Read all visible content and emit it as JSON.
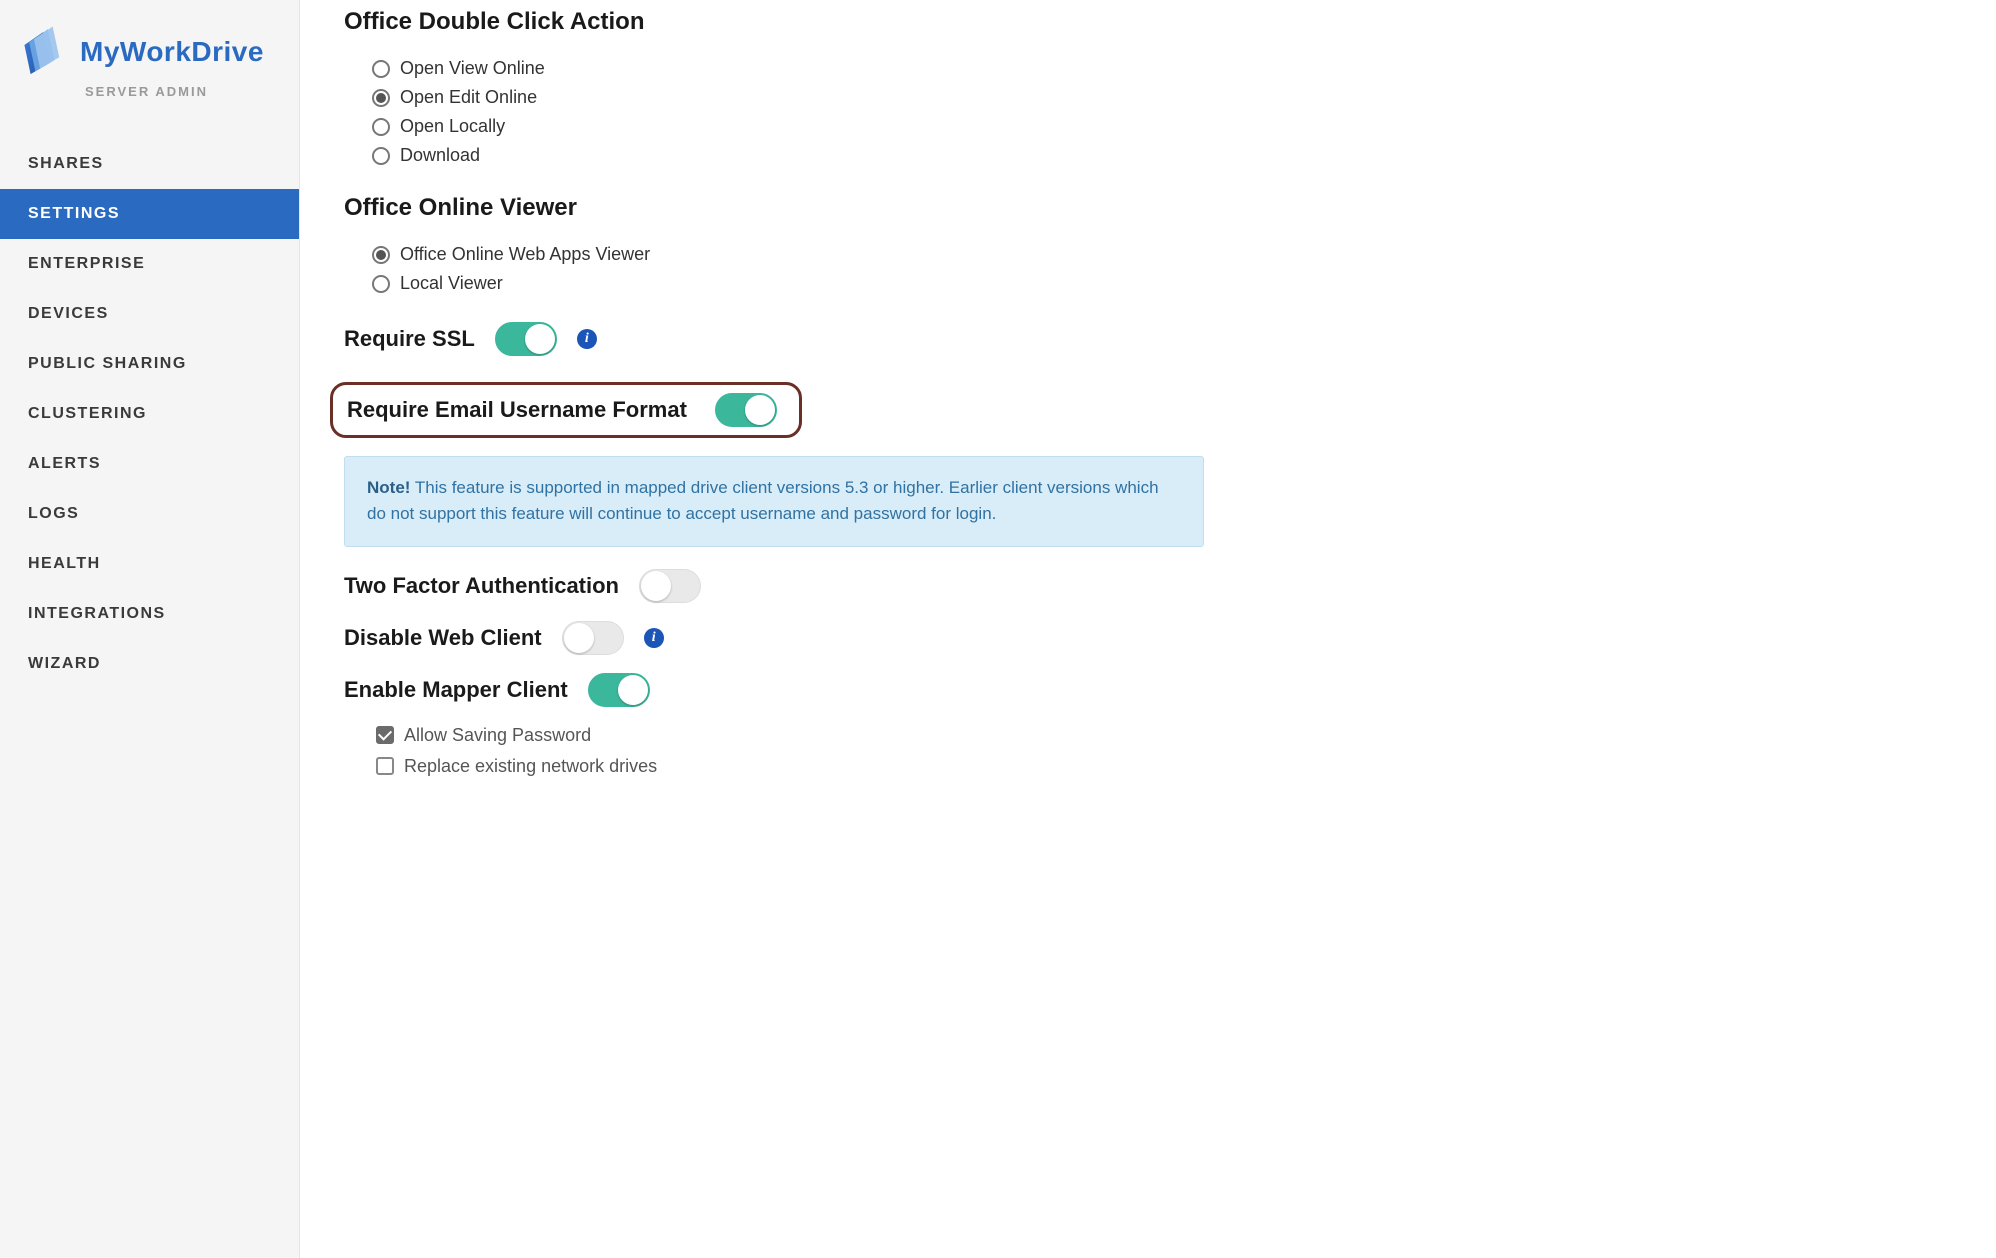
{
  "brand": {
    "name": "MyWorkDrive",
    "subtitle": "SERVER ADMIN"
  },
  "sidebar": {
    "items": [
      {
        "label": "SHARES",
        "active": false
      },
      {
        "label": "SETTINGS",
        "active": true
      },
      {
        "label": "ENTERPRISE",
        "active": false
      },
      {
        "label": "DEVICES",
        "active": false
      },
      {
        "label": "PUBLIC SHARING",
        "active": false
      },
      {
        "label": "CLUSTERING",
        "active": false
      },
      {
        "label": "ALERTS",
        "active": false
      },
      {
        "label": "LOGS",
        "active": false
      },
      {
        "label": "HEALTH",
        "active": false
      },
      {
        "label": "INTEGRATIONS",
        "active": false
      },
      {
        "label": "WIZARD",
        "active": false
      }
    ]
  },
  "sections": {
    "doubleClick": {
      "title": "Office Double Click Action",
      "options": [
        {
          "label": "Open View Online",
          "checked": false
        },
        {
          "label": "Open Edit Online",
          "checked": true
        },
        {
          "label": "Open Locally",
          "checked": false
        },
        {
          "label": "Download",
          "checked": false
        }
      ]
    },
    "onlineViewer": {
      "title": "Office Online Viewer",
      "options": [
        {
          "label": "Office Online Web Apps Viewer",
          "checked": true
        },
        {
          "label": "Local Viewer",
          "checked": false
        }
      ]
    },
    "requireSsl": {
      "label": "Require SSL",
      "on": true
    },
    "requireEmail": {
      "label": "Require Email Username Format",
      "on": true
    },
    "note": {
      "prefix": "Note!",
      "text": "This feature is supported in mapped drive client versions 5.3 or higher. Earlier client versions which do not support this feature will continue to accept username and password for login."
    },
    "twoFactor": {
      "label": "Two Factor Authentication",
      "on": false
    },
    "disableWeb": {
      "label": "Disable Web Client",
      "on": false
    },
    "enableMapper": {
      "label": "Enable Mapper Client",
      "on": true,
      "checkboxes": [
        {
          "label": "Allow Saving Password",
          "checked": true
        },
        {
          "label": "Replace existing network drives",
          "checked": false
        }
      ]
    }
  }
}
